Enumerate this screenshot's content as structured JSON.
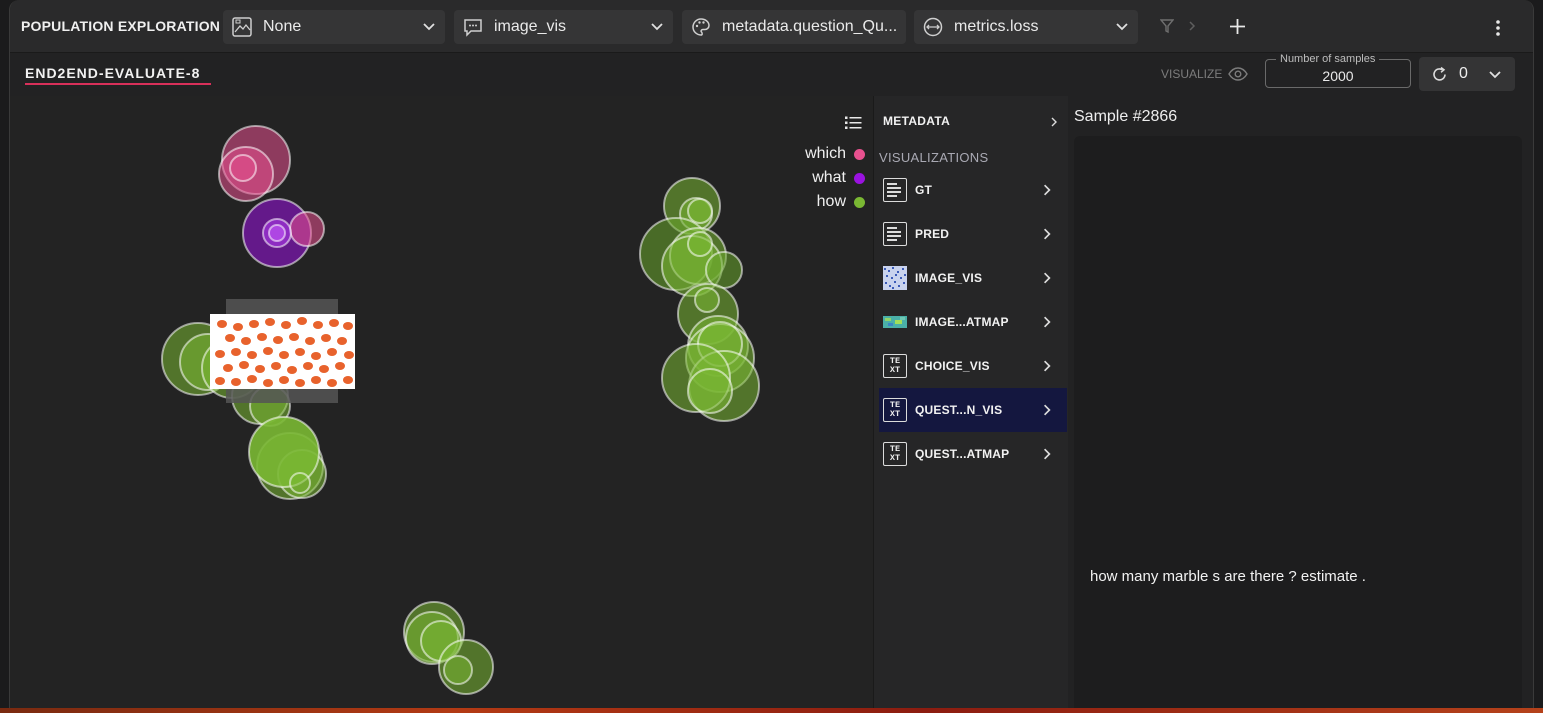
{
  "toolbar": {
    "title": "POPULATION EXPLORATION",
    "dropdowns": [
      {
        "label": "None",
        "icon": "image-chart-icon"
      },
      {
        "label": "image_vis",
        "icon": "comment-icon"
      },
      {
        "label": "metadata.question_Qu...",
        "icon": "palette-icon"
      },
      {
        "label": "metrics.loss",
        "icon": "size-icon"
      }
    ],
    "icons": [
      "filter-icon",
      "chevron-right-icon",
      "plus-icon",
      "more-vert-icon"
    ]
  },
  "tabrow": {
    "tab_label": "END2END-EVALUATE-8",
    "visualize_label": "VISUALIZE",
    "samples_label": "Number of samples",
    "samples_value": "2000",
    "refresh_count": "0"
  },
  "scatter": {
    "legend": [
      {
        "label": "which",
        "color": "#e8518f"
      },
      {
        "label": "what",
        "color": "#9a12e0"
      },
      {
        "label": "how",
        "color": "#7ab833"
      }
    ]
  },
  "panel": {
    "metadata_label": "METADATA",
    "visualizations_label": "VISUALIZATIONS",
    "items": [
      {
        "label": "GT",
        "icon": "lines-icon",
        "active": false
      },
      {
        "label": "PRED",
        "icon": "lines-icon",
        "active": false
      },
      {
        "label": "IMAGE_VIS",
        "icon": "image-thumb-icon",
        "active": false
      },
      {
        "label": "IMAGE...ATMAP",
        "icon": "heatmap-thumb-icon",
        "active": false
      },
      {
        "label": "CHOICE_VIS",
        "icon": "text-icon",
        "active": false
      },
      {
        "label": "QUEST...N_VIS",
        "icon": "text-icon",
        "active": true
      },
      {
        "label": "QUEST...ATMAP",
        "icon": "text-icon",
        "active": false
      }
    ],
    "text_icon_glyph_top": "TE",
    "text_icon_glyph_bottom": "XT"
  },
  "sample": {
    "title": "Sample #2866",
    "text": "how many marble s are there ? estimate ."
  }
}
